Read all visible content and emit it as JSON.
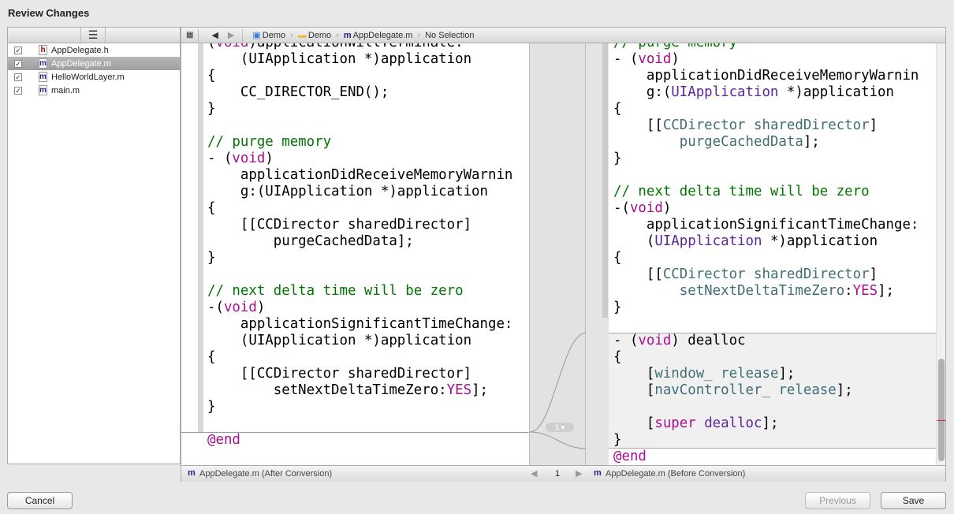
{
  "window": {
    "title": "Review Changes"
  },
  "files": [
    {
      "name": "AppDelegate.h",
      "type": "h",
      "checked": true
    },
    {
      "name": "AppDelegate.m",
      "type": "m",
      "checked": true,
      "selected": true
    },
    {
      "name": "HelloWorldLayer.m",
      "type": "m",
      "checked": true
    },
    {
      "name": "main.m",
      "type": "m",
      "checked": true
    }
  ],
  "jumpbar": {
    "crumbs": [
      "Demo",
      "Demo",
      "AppDelegate.m",
      "No Selection"
    ]
  },
  "left_code": [
    [
      [
        "(",
        ""
      ],
      [
        "void",
        "kw"
      ],
      [
        ")applicationWillTerminate:",
        ""
      ]
    ],
    [
      [
        "    (UIApplication *)application",
        ""
      ]
    ],
    [
      [
        "{",
        ""
      ]
    ],
    [
      [
        "    CC_DIRECTOR_END();",
        ""
      ]
    ],
    [
      [
        "}",
        ""
      ]
    ],
    [],
    [
      [
        "// purge memory",
        "cm"
      ]
    ],
    [
      [
        "- (",
        ""
      ],
      [
        "void",
        "kw"
      ],
      [
        ")",
        ""
      ]
    ],
    [
      [
        "    applicationDidReceiveMemoryWarnin",
        ""
      ]
    ],
    [
      [
        "    g:(UIApplication *)application",
        ""
      ]
    ],
    [
      [
        "{",
        ""
      ]
    ],
    [
      [
        "    [[CCDirector sharedDirector]",
        ""
      ]
    ],
    [
      [
        "        purgeCachedData];",
        ""
      ]
    ],
    [
      [
        "}",
        ""
      ]
    ],
    [],
    [
      [
        "// next delta time will be zero",
        "cm"
      ]
    ],
    [
      [
        "-(",
        ""
      ],
      [
        "void",
        "kw"
      ],
      [
        ")",
        ""
      ]
    ],
    [
      [
        "    applicationSignificantTimeChange:",
        ""
      ]
    ],
    [
      [
        "    (UIApplication *)application",
        ""
      ]
    ],
    [
      [
        "{",
        ""
      ]
    ],
    [
      [
        "    [[CCDirector sharedDirector]",
        ""
      ]
    ],
    [
      [
        "        setNextDeltaTimeZero:",
        ""
      ],
      [
        "YES",
        "kw"
      ],
      [
        "];",
        ""
      ]
    ],
    [
      [
        "}",
        ""
      ]
    ],
    [],
    [
      [
        "@end",
        "kw"
      ]
    ]
  ],
  "right_code": [
    [
      [
        "// purge memory",
        "cm"
      ]
    ],
    [
      [
        "- (",
        ""
      ],
      [
        "void",
        "kw"
      ],
      [
        ")",
        ""
      ]
    ],
    [
      [
        "    applicationDidReceiveMemoryWarnin",
        ""
      ]
    ],
    [
      [
        "    g:(",
        ""
      ],
      [
        "UIApplication",
        "cls"
      ],
      [
        " *)application",
        ""
      ]
    ],
    [
      [
        "{",
        ""
      ]
    ],
    [
      [
        "    [[",
        ""
      ],
      [
        "CCDirector",
        "tl"
      ],
      [
        " ",
        ""
      ],
      [
        "sharedDirector",
        "tl"
      ],
      [
        "]",
        ""
      ]
    ],
    [
      [
        "        ",
        ""
      ],
      [
        "purgeCachedData",
        "tl"
      ],
      [
        "];",
        ""
      ]
    ],
    [
      [
        "}",
        ""
      ]
    ],
    [],
    [
      [
        "// next delta time will be zero",
        "cm"
      ]
    ],
    [
      [
        "-(",
        ""
      ],
      [
        "void",
        "kw"
      ],
      [
        ")",
        ""
      ]
    ],
    [
      [
        "    applicationSignificantTimeChange:",
        ""
      ]
    ],
    [
      [
        "    (",
        ""
      ],
      [
        "UIApplication",
        "cls"
      ],
      [
        " *)application",
        ""
      ]
    ],
    [
      [
        "{",
        ""
      ]
    ],
    [
      [
        "    [[",
        ""
      ],
      [
        "CCDirector",
        "tl"
      ],
      [
        " ",
        ""
      ],
      [
        "sharedDirector",
        "tl"
      ],
      [
        "]",
        ""
      ]
    ],
    [
      [
        "        ",
        ""
      ],
      [
        "setNextDeltaTimeZero",
        "tl"
      ],
      [
        ":",
        ""
      ],
      [
        "YES",
        "kw"
      ],
      [
        "];",
        ""
      ]
    ],
    [
      [
        "}",
        ""
      ]
    ],
    [],
    [
      [
        "- (",
        ""
      ],
      [
        "void",
        "kw"
      ],
      [
        ") dealloc",
        ""
      ]
    ],
    [
      [
        "{",
        ""
      ]
    ],
    [
      [
        "    [",
        ""
      ],
      [
        "window_",
        "tl"
      ],
      [
        " ",
        ""
      ],
      [
        "release",
        "tl"
      ],
      [
        "];",
        ""
      ]
    ],
    [
      [
        "    [",
        ""
      ],
      [
        "navController_",
        "tl"
      ],
      [
        " ",
        ""
      ],
      [
        "release",
        "tl"
      ],
      [
        "];",
        ""
      ]
    ],
    [],
    [
      [
        "    [",
        ""
      ],
      [
        "super",
        "kw"
      ],
      [
        " ",
        ""
      ],
      [
        "dealloc",
        "cls"
      ],
      [
        "];",
        ""
      ]
    ],
    [
      [
        "}",
        ""
      ]
    ],
    [
      [
        "@end",
        "kw"
      ]
    ]
  ],
  "diff": {
    "change_count": "1"
  },
  "bottom": {
    "left_file": "AppDelegate.m (After Conversion)",
    "page": "1",
    "right_file": "AppDelegate.m (Before Conversion)"
  },
  "buttons": {
    "cancel": "Cancel",
    "previous": "Previous",
    "save": "Save"
  }
}
